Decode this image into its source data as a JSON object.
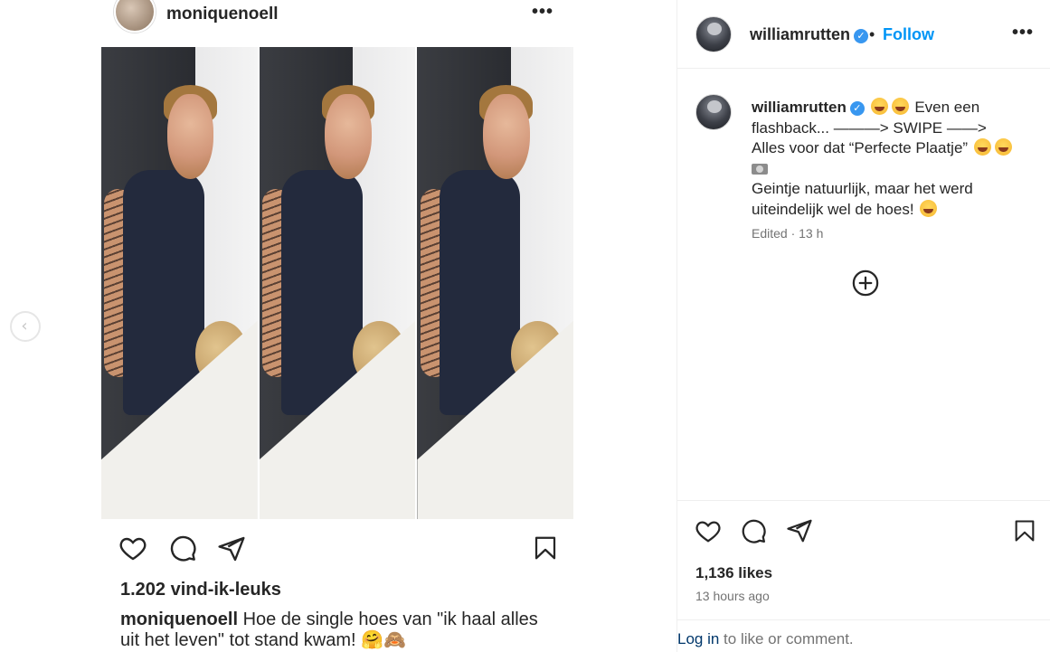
{
  "left_post": {
    "username": "moniquenoell",
    "likes": "1.202 vind-ik-leuks",
    "caption_username": "moniquenoell",
    "caption_text": "Hoe de single hoes van \"ik haal alles uit het leven\" tot stand kwam! 🤗🙈"
  },
  "sidebar": {
    "username": "williamrutten",
    "separator": "•",
    "follow_label": "Follow",
    "comment": {
      "username": "williamrutten",
      "line1": "Even een flashback... ———> SWIPE ——>",
      "line2": "Alles voor dat “Perfecte Plaatje”",
      "line3": "Geintje natuurlijk, maar het werd uiteindelijk wel de hoes!",
      "meta": "Edited · 13 h"
    },
    "likes": "1,136 likes",
    "time": "13 hours ago",
    "login_link": "Log in",
    "login_rest": " to like or comment."
  },
  "icons": [
    "chevron-left-icon",
    "more-icon",
    "heart-icon",
    "comment-icon",
    "share-icon",
    "bookmark-icon",
    "verified-icon",
    "add-circle-icon"
  ],
  "colors": {
    "follow": "#0095f6",
    "verified": "#3897f0",
    "muted": "#737373",
    "link": "#00376b"
  }
}
